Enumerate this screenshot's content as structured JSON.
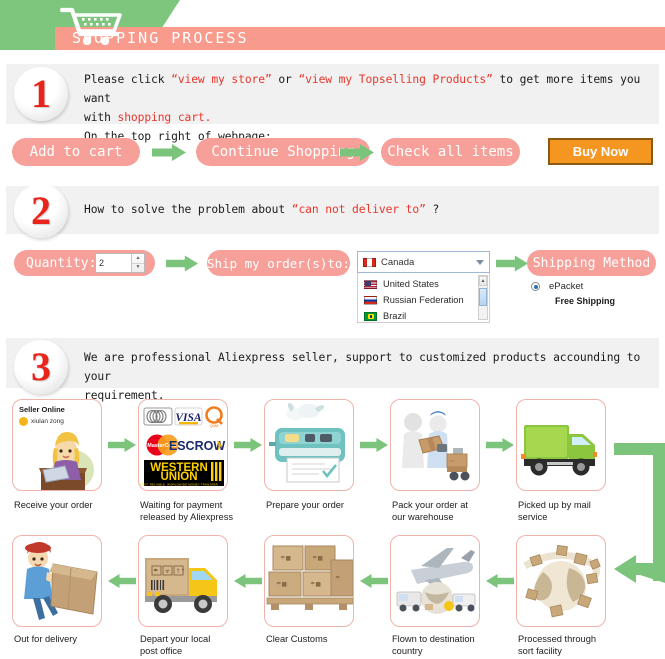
{
  "header": {
    "title": "SHOPPING PROCESS",
    "cart_icon": "shopping-cart-icon",
    "green_color": "#7ec67e",
    "band_color": "#f89a8c"
  },
  "steps": [
    {
      "number": "1",
      "lines": [
        {
          "segments": [
            {
              "text": "Please click  ",
              "accent": false
            },
            {
              "text": "“view my store”",
              "accent": true
            },
            {
              "text": " or  ",
              "accent": false
            },
            {
              "text": "“view my Topselling Products”",
              "accent": true
            },
            {
              "text": " to get more items you want",
              "accent": false
            }
          ]
        },
        {
          "segments": [
            {
              "text": "with ",
              "accent": false
            },
            {
              "text": "shopping cart.",
              "accent": true
            }
          ]
        },
        {
          "segments": [
            {
              "text": "On the top right of webpage:",
              "accent": false
            }
          ]
        }
      ]
    },
    {
      "number": "2",
      "lines": [
        {
          "segments": [
            {
              "text": "How to solve the problem about  ",
              "accent": false
            },
            {
              "text": "“can not deliver to”",
              "accent": true
            },
            {
              "text": " ?",
              "accent": false
            }
          ]
        }
      ]
    },
    {
      "number": "3",
      "lines": [
        {
          "segments": [
            {
              "text": "We are professional Aliexpress seller, support to customized products accounding to your",
              "accent": false
            }
          ]
        },
        {
          "segments": [
            {
              "text": "requirement.",
              "accent": false
            }
          ]
        }
      ]
    }
  ],
  "step1_buttons": {
    "add_to_cart": "Add to cart",
    "continue_shopping": "Continue Shopping",
    "check_all_items": "Check all items",
    "buy_now": "Buy Now",
    "pill_color": "#f7a09a",
    "buy_now_color": "#f59620"
  },
  "step2_row": {
    "quantity_label": "Quantity:",
    "quantity_value": "2",
    "ship_to_label": "Ship my order(s)to:",
    "shipping_method_label": "Shipping Method",
    "country_select": {
      "selected": "Canada",
      "selected_flag": "canada-flag-icon",
      "options": [
        {
          "label": "United States",
          "flag": "united-states-flag-icon"
        },
        {
          "label": "Russian Federation",
          "flag": "russian-federation-flag-icon"
        },
        {
          "label": "Brazil",
          "flag": "brazil-flag-icon"
        }
      ]
    },
    "shipping_option": {
      "name": "ePacket",
      "note": "Free Shipping",
      "selected": true
    }
  },
  "flow": {
    "row1": [
      {
        "caption": "Receive your order",
        "icon": "seller-online-illustration",
        "seller_panel_title": "Seller Online",
        "seller_name": "xiulan zong"
      },
      {
        "caption": "Waiting for payment\nreleased by Aliexpress",
        "icon": "payment-logos",
        "logos": [
          "card-stripe-logo",
          "VISA",
          "QIWI",
          "MasterCard",
          "ESCROW",
          "WESTERN UNION"
        ],
        "wu_tagline": "FAST. RELIABLE. WORLDWIDE MONEY TRANSFER"
      },
      {
        "caption": "Prepare your order",
        "icon": "printer-packaging-illustration"
      },
      {
        "caption": "Pack your order at\nour warehouse",
        "icon": "workers-packing-illustration"
      },
      {
        "caption": "Picked up by mail\nservice",
        "icon": "green-delivery-truck-icon"
      }
    ],
    "row2": [
      {
        "caption": "Out for delivery",
        "icon": "postman-carrying-parcel-illustration"
      },
      {
        "caption": "Depart your local\npost office",
        "icon": "yellow-delivery-truck-icon"
      },
      {
        "caption": "Clear Customs",
        "icon": "stacked-boxes-pallet-icon"
      },
      {
        "caption": "Flown to destination\ncountry",
        "icon": "airplane-cargo-illustration"
      },
      {
        "caption": "Processed through\nsort facility",
        "icon": "globe-with-parcels-icon"
      }
    ],
    "arrow_color": "#7cc47c",
    "card_border_color": "#f0b3ab"
  }
}
